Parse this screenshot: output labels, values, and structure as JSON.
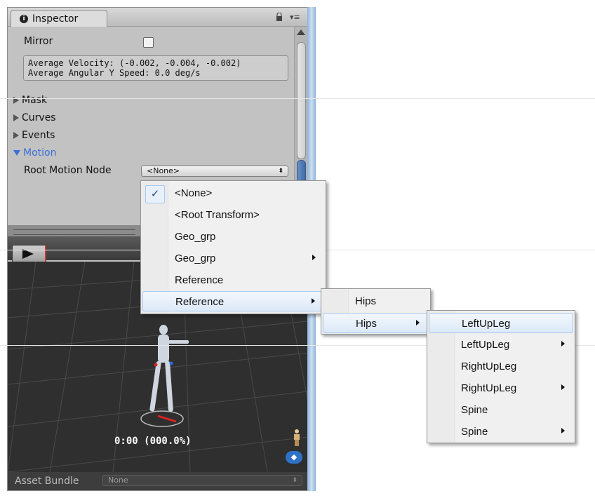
{
  "inspector": {
    "tab_title": "Inspector",
    "tab_icon": "info-icon",
    "mirror": {
      "label": "Mirror",
      "checked": false
    },
    "stats": {
      "velocity": "Average Velocity: (-0.002, -0.004, -0.002)",
      "angular": "Average Angular Y Speed: 0.0 deg/s"
    },
    "foldouts": [
      {
        "label": "Mask",
        "expanded": false
      },
      {
        "label": "Curves",
        "expanded": false
      },
      {
        "label": "Events",
        "expanded": false
      },
      {
        "label": "Motion",
        "expanded": true
      }
    ],
    "root_motion": {
      "label": "Root Motion Node",
      "value": "<None>"
    },
    "preview": {
      "time": "0:00 (000.0%)"
    },
    "asset_bundle": {
      "label": "Asset Bundle",
      "value": "None"
    }
  },
  "menus": {
    "root": [
      {
        "label": "<None>",
        "checked": true,
        "submenu": false
      },
      {
        "label": "<Root Transform>",
        "checked": false,
        "submenu": false
      },
      {
        "label": "Geo_grp",
        "checked": false,
        "submenu": false
      },
      {
        "label": "Geo_grp",
        "checked": false,
        "submenu": true
      },
      {
        "label": "Reference",
        "checked": false,
        "submenu": false
      },
      {
        "label": "Reference",
        "checked": false,
        "submenu": true,
        "highlighted": true
      }
    ],
    "reference": [
      {
        "label": "Hips",
        "submenu": false
      },
      {
        "label": "Hips",
        "submenu": true,
        "highlighted": true
      }
    ],
    "hips": [
      {
        "label": "LeftUpLeg",
        "submenu": false,
        "highlighted": true
      },
      {
        "label": "LeftUpLeg",
        "submenu": true
      },
      {
        "label": "RightUpLeg",
        "submenu": false
      },
      {
        "label": "RightUpLeg",
        "submenu": true
      },
      {
        "label": "Spine",
        "submenu": false
      },
      {
        "label": "Spine",
        "submenu": true
      }
    ]
  },
  "colors": {
    "accent": "#3a6fd6",
    "menu_highlight": "#dde9f8",
    "panel": "#c2c2c2"
  }
}
